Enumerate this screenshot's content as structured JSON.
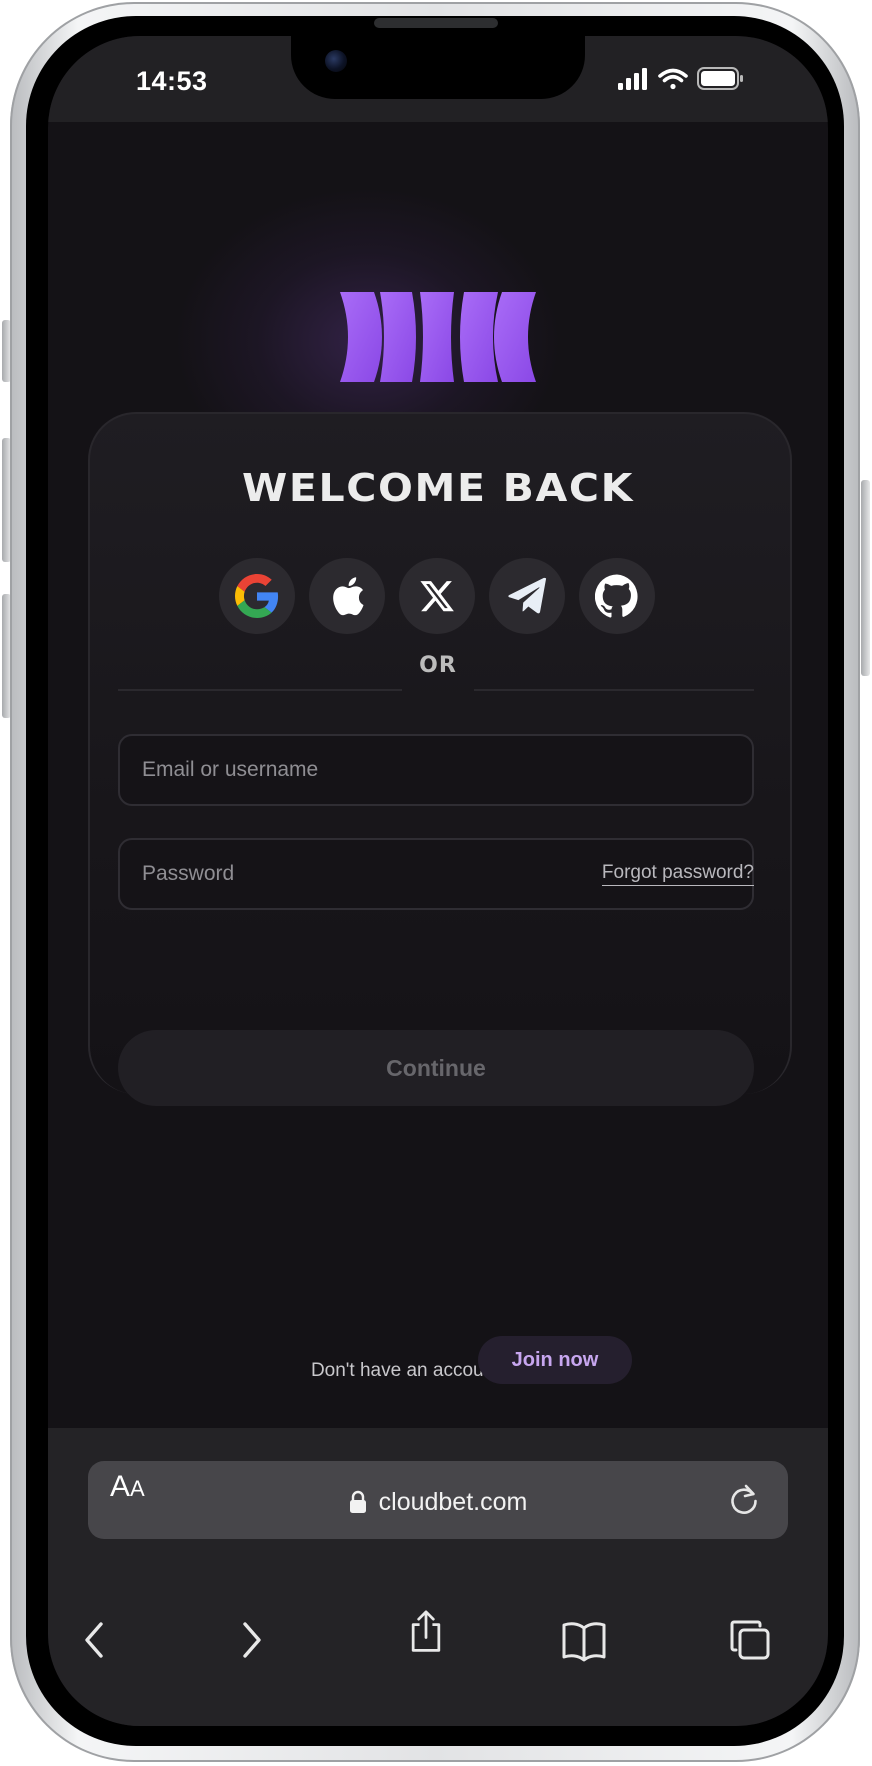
{
  "status_bar": {
    "time": "14:53"
  },
  "brand": {
    "accent": "#9b5cf2"
  },
  "login": {
    "title": "WELCOME BACK",
    "social": [
      {
        "name": "google",
        "icon": "google-icon"
      },
      {
        "name": "apple",
        "icon": "apple-icon"
      },
      {
        "name": "x",
        "icon": "x-icon"
      },
      {
        "name": "telegram",
        "icon": "telegram-icon"
      },
      {
        "name": "github",
        "icon": "github-icon"
      }
    ],
    "divider_text": "OR",
    "email_placeholder": "Email or username",
    "password_placeholder": "Password",
    "forgot_password": "Forgot password?",
    "continue_label": "Continue",
    "signup_prompt": "Don't have an account?",
    "join_label": "Join now"
  },
  "browser": {
    "text_size_big": "A",
    "text_size_small": "A",
    "url": "cloudbet.com",
    "icons": [
      "lock-icon",
      "reload-icon",
      "back-icon",
      "forward-icon",
      "share-icon",
      "bookmarks-icon",
      "tabs-icon"
    ]
  }
}
